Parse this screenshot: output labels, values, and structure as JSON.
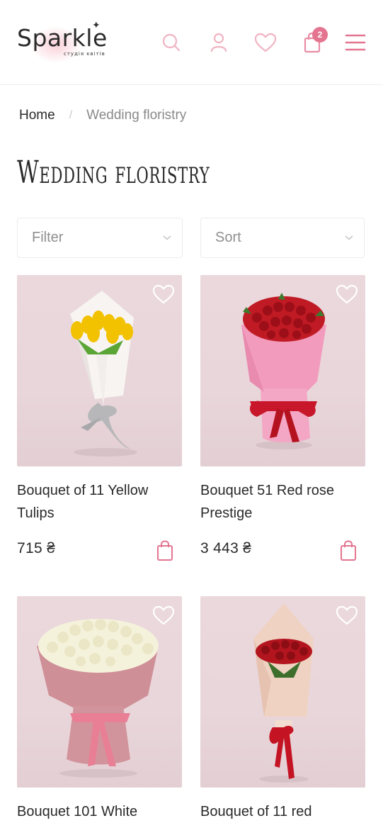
{
  "header": {
    "logo_text": "Sparkle",
    "logo_subtitle": "студія квітів",
    "cart_count": "2",
    "accent_color": "#e47590",
    "icons": [
      "search-icon",
      "user-icon",
      "heart-icon",
      "cart-icon",
      "menu-icon"
    ]
  },
  "breadcrumb": {
    "home": "Home",
    "separator": "/",
    "current": "Wedding floristry"
  },
  "page_title": "Wedding floristry",
  "filters": {
    "filter_label": "Filter",
    "sort_label": "Sort"
  },
  "products": [
    {
      "name": "Bouquet of 11 Yellow Tulips",
      "price": "715 ₴",
      "flower": "yellow tulips",
      "wrap": "white"
    },
    {
      "name": "Bouquet 51 Red rose Prestige",
      "price": "3 443 ₴",
      "flower": "red roses",
      "wrap": "pink"
    },
    {
      "name": "Bouquet 101 White",
      "price": "",
      "flower": "white roses",
      "wrap": "dusty pink"
    },
    {
      "name": "Bouquet of 11 red",
      "price": "",
      "flower": "red roses",
      "wrap": "beige"
    }
  ]
}
